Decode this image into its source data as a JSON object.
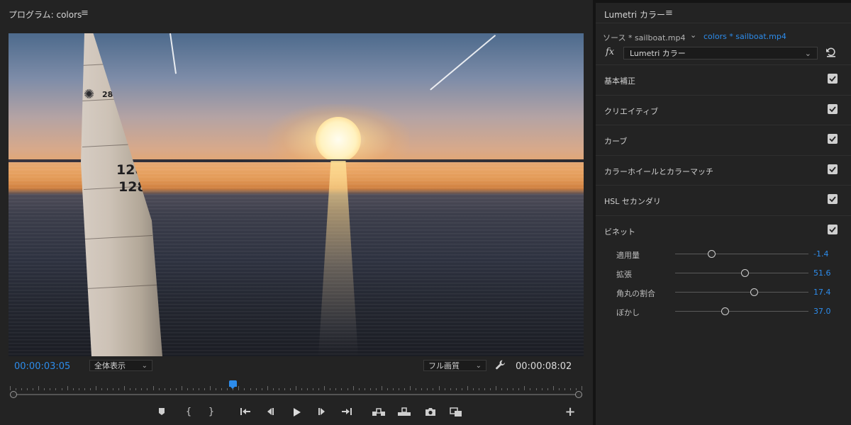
{
  "program": {
    "title": "プログラム: colors",
    "current_time": "00:00:03:05",
    "duration": "00:00:08:02",
    "zoom_select": "全体表示",
    "quality_select": "フル画質",
    "playhead_fraction": 0.39,
    "sail_numbers": [
      "28",
      "128",
      "128"
    ]
  },
  "lumetri": {
    "title": "Lumetri カラー",
    "source_tab": "ソース * sailboat.mp4",
    "sequence_tab": "colors * sailboat.mp4",
    "fx_label": "fx",
    "effect_name": "Lumetri カラー",
    "sections": [
      {
        "label": "基本補正",
        "checked": true
      },
      {
        "label": "クリエイティブ",
        "checked": true
      },
      {
        "label": "カーブ",
        "checked": true
      },
      {
        "label": "カラーホイールとカラーマッチ",
        "checked": true
      },
      {
        "label": "HSL セカンダリ",
        "checked": true
      },
      {
        "label": "ビネット",
        "checked": true
      }
    ],
    "vignette_sliders": [
      {
        "label": "適用量",
        "value": "-1.4",
        "fraction": 0.27
      },
      {
        "label": "拡張",
        "value": "51.6",
        "fraction": 0.52
      },
      {
        "label": "角丸の割合",
        "value": "17.4",
        "fraction": 0.59
      },
      {
        "label": "ぼかし",
        "value": "37.0",
        "fraction": 0.37
      }
    ]
  },
  "colors": {
    "accent": "#2d8ceb",
    "panel_bg": "#232323"
  },
  "icons": {
    "menu": "hamburger-icon",
    "reset": "reset-icon",
    "settings": "wrench-icon",
    "add": "plus-icon"
  }
}
